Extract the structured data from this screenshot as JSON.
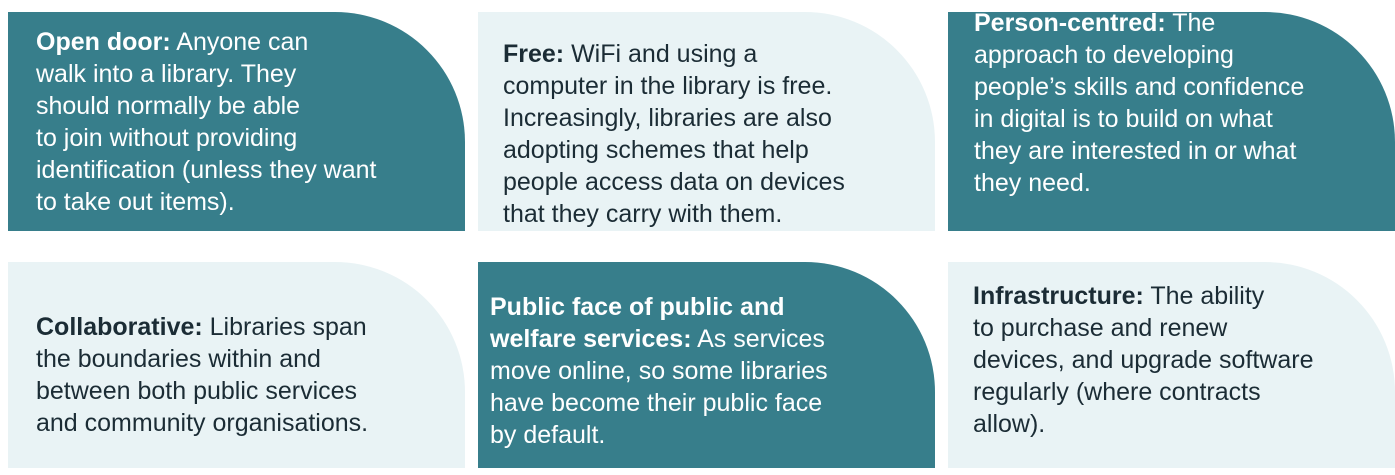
{
  "cards": [
    {
      "term": "Open door:",
      "text": " Anyone can\nwalk into a library. They\nshould normally be able\nto join without providing\nidentification (unless they want\nto take out items)."
    },
    {
      "term": "Free:",
      "text": " WiFi and using a\ncomputer in the library is free.\nIncreasingly, libraries are also\nadopting schemes that help\npeople access data on devices\nthat they carry with them."
    },
    {
      "term": "Person-centred:",
      "text": " The\napproach to developing\npeople’s skills and confidence\nin digital is to build on what\nthey are interested in or what\nthey need."
    },
    {
      "term": "Collaborative:",
      "text": " Libraries span\nthe boundaries within and\nbetween both public services\nand community organisations."
    },
    {
      "term": "Public face of public and\nwelfare services:",
      "text": " As services\nmove online, so some libraries\nhave become their public face\nby default."
    },
    {
      "term": "Infrastructure:",
      "text": " The ability\nto purchase and renew\ndevices, and upgrade software\nregularly (where contracts\nallow)."
    }
  ],
  "colors": {
    "dark_card": "#377e8b",
    "light_card": "#e9f3f5",
    "dark_text": "#1b2c35",
    "light_text": "#ffffff"
  }
}
